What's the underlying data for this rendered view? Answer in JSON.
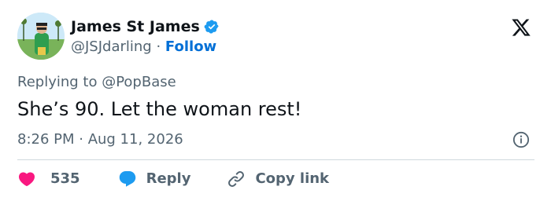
{
  "author": {
    "display_name": "James St James",
    "handle": "@JSJdarling",
    "separator": " · ",
    "follow_label": "Follow"
  },
  "tweet": {
    "replying_to": "Replying to @PopBase",
    "text": "She’s 90. Let the woman rest!",
    "timestamp": "8:26 PM · Aug 11, 2026"
  },
  "actions": {
    "like_count": "535",
    "reply_label": "Reply",
    "copy_link_label": "Copy link"
  },
  "colors": {
    "like": "#f91880",
    "reply": "#1d9bf0",
    "follow": "#006fd6",
    "verified": "#1d9bf0",
    "secondary_text": "#536471"
  },
  "icons": [
    "x-logo-icon",
    "verified-badge-icon",
    "info-icon",
    "heart-icon",
    "reply-bubble-icon",
    "link-icon"
  ]
}
